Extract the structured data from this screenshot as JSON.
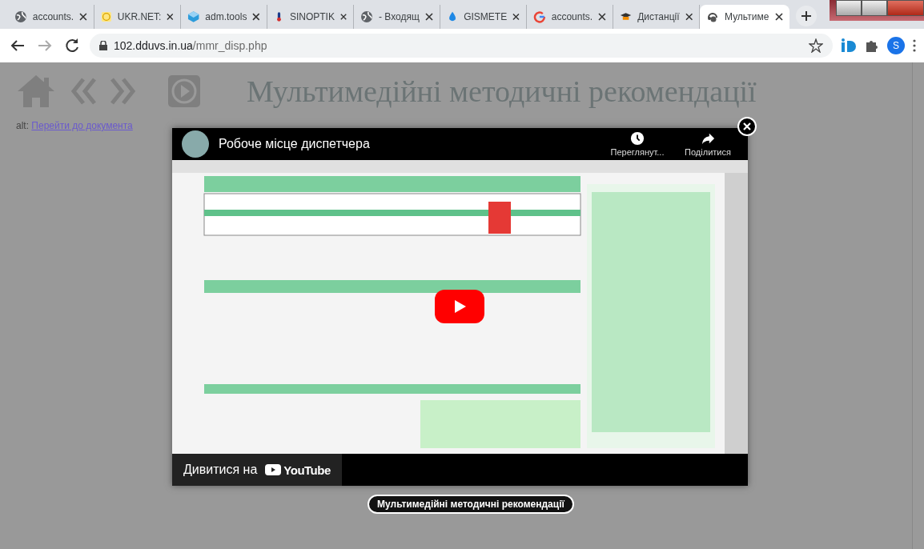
{
  "tabs": [
    {
      "title": "accounts.",
      "selected": false
    },
    {
      "title": "UKR.NET:",
      "selected": false
    },
    {
      "title": "adm.tools",
      "selected": false
    },
    {
      "title": "SINOPTIK",
      "selected": false
    },
    {
      "title": "- Входящ",
      "selected": false
    },
    {
      "title": "GISMETE",
      "selected": false
    },
    {
      "title": "accounts.",
      "selected": false
    },
    {
      "title": "Дистанції",
      "selected": false
    },
    {
      "title": "Мультиме",
      "selected": true
    }
  ],
  "address": {
    "host": "102.dduvs.in.ua",
    "path": "/mmr_disp.php"
  },
  "profile_initial": "S",
  "page": {
    "title": "Мультимедійні методичні рекомендації",
    "alt_label": "alt:",
    "alt_link": "Перейти до документа"
  },
  "video": {
    "title": "Робоче місце диспетчера",
    "actions": [
      {
        "kind": "watch_later",
        "label": "Переглянут..."
      },
      {
        "kind": "share",
        "label": "Поділитися"
      }
    ],
    "watch_on": "Дивитися на",
    "brand": "YouTube",
    "caption": "Мультимедійні методичні рекомендації"
  }
}
